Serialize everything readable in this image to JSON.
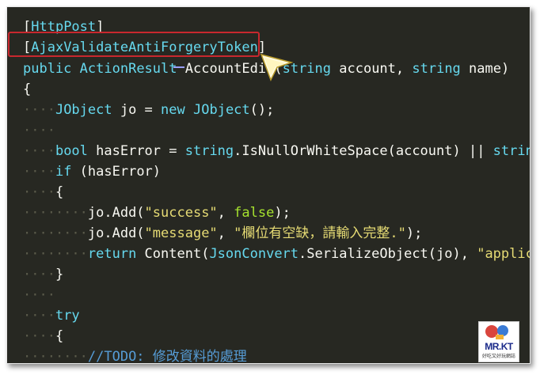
{
  "code": {
    "l1": {
      "open": "[",
      "attr": "HttpPost",
      "close": "]"
    },
    "l2": {
      "open": "[",
      "attr": "AjaxValidateAntiForgeryToken",
      "close": "]"
    },
    "l3": {
      "kw": "public",
      "type": "ActionResult",
      "method": "AccountEdit",
      "paren": "(",
      "t1": "string",
      "p1": " account, ",
      "t2": "string",
      "p2": " name)"
    },
    "l4": {
      "text": "{"
    },
    "l5": {
      "type": "JObject",
      "mid": " jo = ",
      "kw": "new",
      "type2": "JObject",
      "end": "();"
    },
    "l7": {
      "kw": "bool",
      "mid": " hasError = ",
      "type": "string",
      "call": ".IsNullOrWhiteSpace(account) || ",
      "type2": "string"
    },
    "l8": {
      "kw": "if",
      "rest": " (hasError)"
    },
    "l9": {
      "text": "{"
    },
    "l10": {
      "pre": "jo.Add(",
      "str": "\"success\"",
      "mid": ", ",
      "bool": "false",
      "end": ");"
    },
    "l11": {
      "pre": "jo.Add(",
      "str": "\"message\"",
      "mid": ", ",
      "str2": "\"欄位有空缺，請輸入完整.\"",
      "end": ");"
    },
    "l12": {
      "kw": "return",
      "mid": " Content(",
      "type": "JsonConvert",
      "call": ".SerializeObject(jo), ",
      "str": "\"applica"
    },
    "l13": {
      "text": "}"
    },
    "l15": {
      "kw": "try"
    },
    "l16": {
      "text": "{"
    },
    "l17": {
      "cmt": "//TODO: 修改資料的處理"
    }
  },
  "logo": {
    "title": "MR.KT",
    "subtitle": "好吃又好玩網誌"
  },
  "colors": {
    "background": "#272822",
    "highlight_border": "#c8282e"
  },
  "icons": {
    "pointer": "mouse-pointer-icon",
    "logo": "mrkt-logo-icon"
  }
}
